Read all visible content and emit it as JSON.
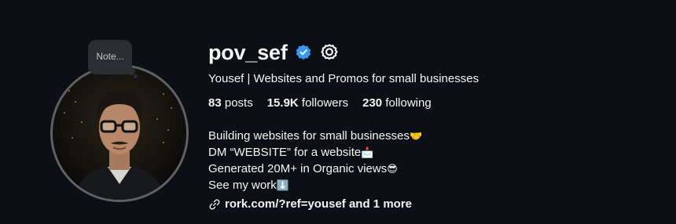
{
  "note": {
    "label": "Note..."
  },
  "profile": {
    "username": "pov_sef",
    "full_name": "Yousef | Websites and Promos for small businesses",
    "verified": true,
    "accent": "#3897f0"
  },
  "stats": {
    "posts": {
      "count": "83",
      "label": "posts"
    },
    "followers": {
      "count": "15.9K",
      "label": "followers"
    },
    "following": {
      "count": "230",
      "label": "following"
    }
  },
  "bio": {
    "lines": [
      {
        "text": "Building websites for small businesses",
        "emoji": "🤝"
      },
      {
        "text": "DM “WEBSITE” for a website",
        "emoji": "📩"
      },
      {
        "text": "Generated 20M+ in Organic views",
        "emoji": "😎"
      },
      {
        "text": "See my work",
        "emoji": "⬇️"
      }
    ]
  },
  "link": {
    "text": "rork.com/?ref=yousef and 1 more",
    "icon": "link-icon"
  },
  "icons": {
    "verified": "verified-badge-icon",
    "settings": "gear-icon"
  }
}
